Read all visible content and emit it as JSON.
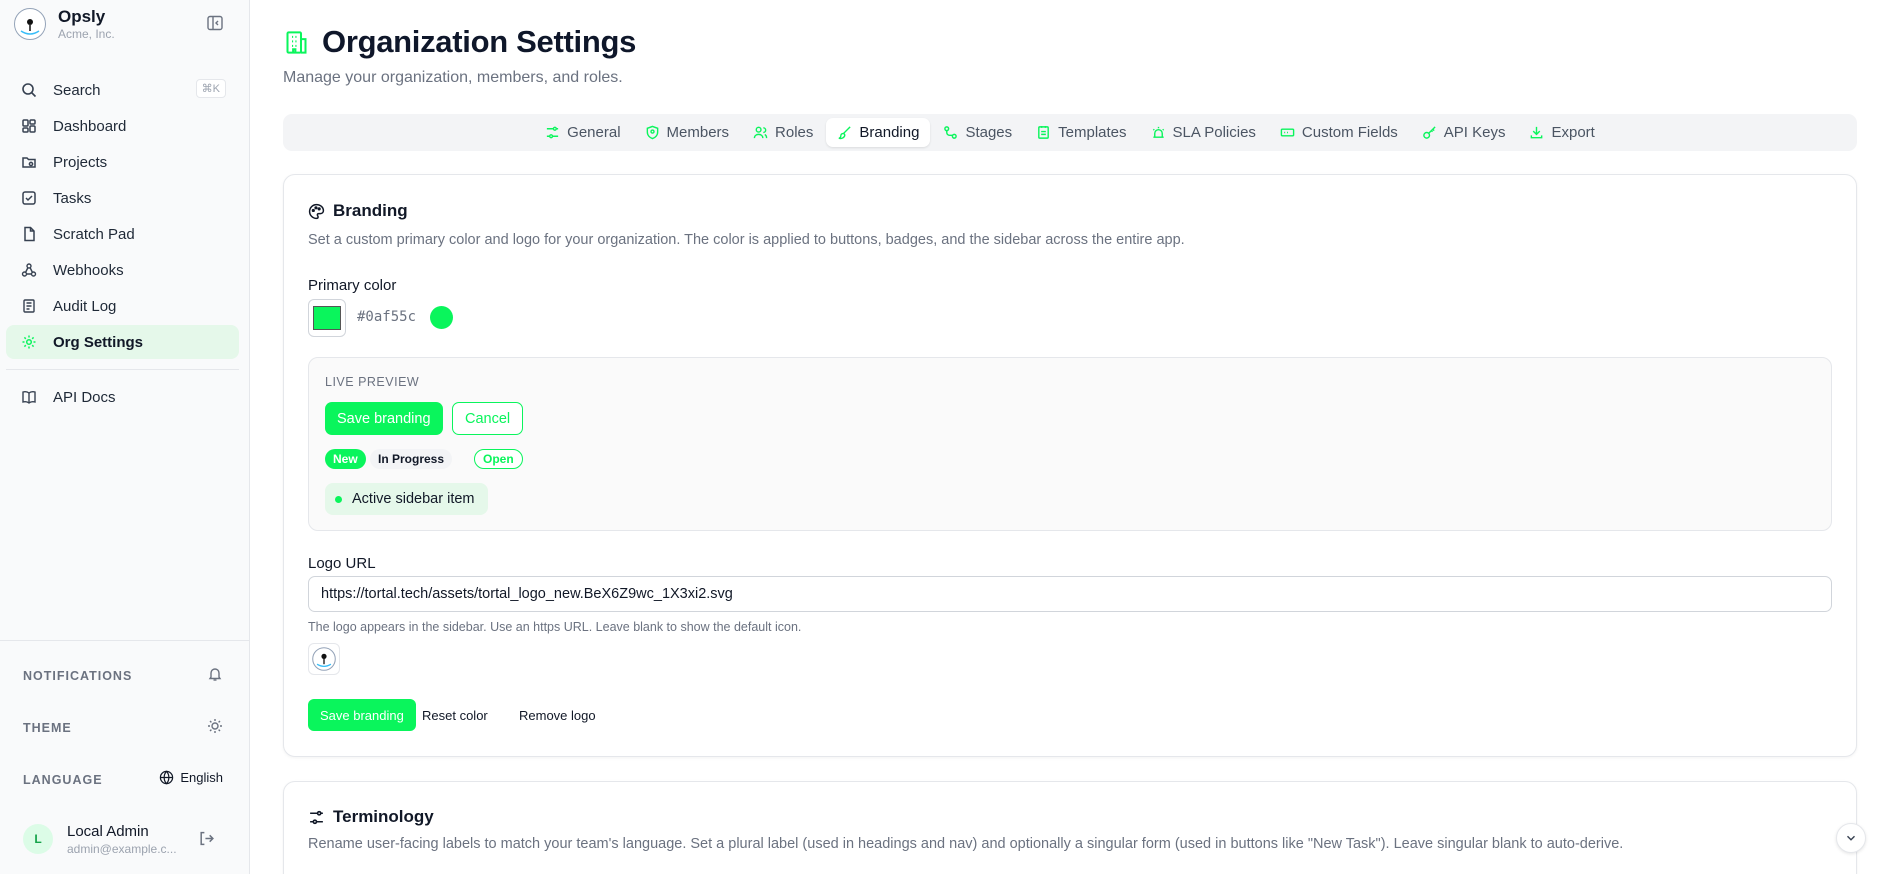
{
  "brand": {
    "name": "Opsly",
    "org": "Acme, Inc."
  },
  "nav": {
    "search": {
      "label": "Search",
      "shortcut": "⌘K"
    },
    "items": [
      {
        "label": "Dashboard",
        "icon": "dashboard-icon"
      },
      {
        "label": "Projects",
        "icon": "projects-icon"
      },
      {
        "label": "Tasks",
        "icon": "tasks-icon"
      },
      {
        "label": "Scratch Pad",
        "icon": "file-icon"
      },
      {
        "label": "Webhooks",
        "icon": "webhook-icon"
      },
      {
        "label": "Audit Log",
        "icon": "audit-icon"
      },
      {
        "label": "Org Settings",
        "icon": "gear-icon"
      }
    ],
    "api_docs": "API Docs"
  },
  "sidebar_bottom": {
    "notifications": "NOTIFICATIONS",
    "theme": "THEME",
    "language": "LANGUAGE",
    "language_value": "English"
  },
  "user": {
    "initial": "L",
    "name": "Local Admin",
    "email": "admin@example.c..."
  },
  "page": {
    "title": "Organization Settings",
    "subtitle": "Manage your organization, members, and roles."
  },
  "tabs": [
    {
      "label": "General"
    },
    {
      "label": "Members"
    },
    {
      "label": "Roles"
    },
    {
      "label": "Branding"
    },
    {
      "label": "Stages"
    },
    {
      "label": "Templates"
    },
    {
      "label": "SLA Policies"
    },
    {
      "label": "Custom Fields"
    },
    {
      "label": "API Keys"
    },
    {
      "label": "Export"
    }
  ],
  "active_tab": "Branding",
  "branding": {
    "title": "Branding",
    "description": "Set a custom primary color and logo for your organization. The color is applied to buttons, badges, and the sidebar across the entire app.",
    "primary_color_label": "Primary color",
    "primary_color": "#0af55c",
    "preview": {
      "heading": "LIVE PREVIEW",
      "save": "Save branding",
      "cancel": "Cancel",
      "badge_new": "New",
      "badge_progress": "In Progress",
      "badge_open": "Open",
      "active_item": "Active sidebar item"
    },
    "logo_label": "Logo URL",
    "logo_url": "https://tortal.tech/assets/tortal_logo_new.BeX6Z9wc_1X3xi2.svg",
    "logo_hint": "The logo appears in the sidebar. Use an https URL. Leave blank to show the default icon.",
    "save": "Save branding",
    "reset": "Reset color",
    "remove": "Remove logo"
  },
  "terminology": {
    "title": "Terminology",
    "description": "Rename user-facing labels to match your team's language. Set a plural label (used in headings and nav) and optionally a singular form (used in buttons like \"New Task\"). Leave singular blank to auto-derive."
  },
  "colors": {
    "accent": "#0af55c",
    "active_bg": "#e5f8ea"
  }
}
